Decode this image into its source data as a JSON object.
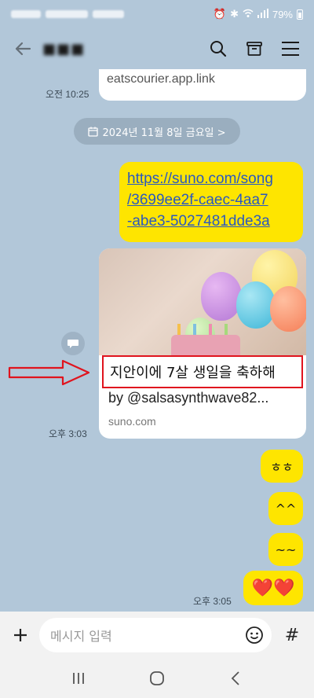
{
  "status": {
    "battery": "79%"
  },
  "header": {
    "title": "■■■"
  },
  "messages": {
    "top_card_text": "eatscourier.app.link",
    "top_card_time": "오전 10:25",
    "date_divider": "2024년 11월 8일 금요일 >",
    "link_lines": [
      "https://suno.com/song",
      "/3699ee2f-caec-4aa7",
      "-abe3-5027481dde3a"
    ],
    "preview_title": "지안이에 7살 생일을 축하해",
    "preview_subtitle": "by @salsasynthwave82...",
    "preview_domain": "suno.com",
    "preview_time": "오후 3:03",
    "reply1": "ㅎㅎ",
    "reply2": "^^",
    "reply3": "~~",
    "reply4": "❤️❤️",
    "last_time": "오후 3:05"
  },
  "input": {
    "placeholder": "메시지 입력",
    "hash_label": "#"
  },
  "colors": {
    "chat_bg": "#b2c7d9",
    "my_bubble": "#fee500",
    "link_color": "#2a58c0",
    "annotation_red": "#e0141e"
  },
  "icons": [
    "back-arrow-icon",
    "search-icon",
    "archive-icon",
    "menu-icon",
    "calendar-icon",
    "share-icon",
    "plus-icon",
    "emoji-icon",
    "nav-recents-icon",
    "nav-home-icon",
    "nav-back-icon"
  ]
}
